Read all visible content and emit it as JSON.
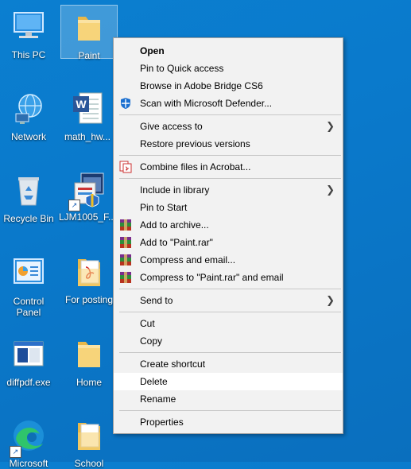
{
  "desktop": {
    "icons": [
      {
        "label": "This PC"
      },
      {
        "label": "Paint"
      },
      {
        "label": "Network"
      },
      {
        "label": "math_hw..."
      },
      {
        "label": "Recycle Bin"
      },
      {
        "label": "LJM1005_F..."
      },
      {
        "label": "Control Panel"
      },
      {
        "label": "For posting"
      },
      {
        "label": "diffpdf.exe"
      },
      {
        "label": "Home"
      },
      {
        "label": "Microsoft"
      },
      {
        "label": "School"
      }
    ]
  },
  "menu": {
    "items": {
      "open": "Open",
      "pin_quick": "Pin to Quick access",
      "browse_bridge": "Browse in Adobe Bridge CS6",
      "scan_defender": "Scan with Microsoft Defender...",
      "give_access": "Give access to",
      "restore": "Restore previous versions",
      "combine": "Combine files in Acrobat...",
      "include_library": "Include in library",
      "pin_start": "Pin to Start",
      "add_archive": "Add to archive...",
      "add_rar": "Add to \"Paint.rar\"",
      "compress_email": "Compress and email...",
      "compress_rar_email": "Compress to \"Paint.rar\" and email",
      "send_to": "Send to",
      "cut": "Cut",
      "copy": "Copy",
      "create_shortcut": "Create shortcut",
      "delete": "Delete",
      "rename": "Rename",
      "properties": "Properties"
    }
  }
}
